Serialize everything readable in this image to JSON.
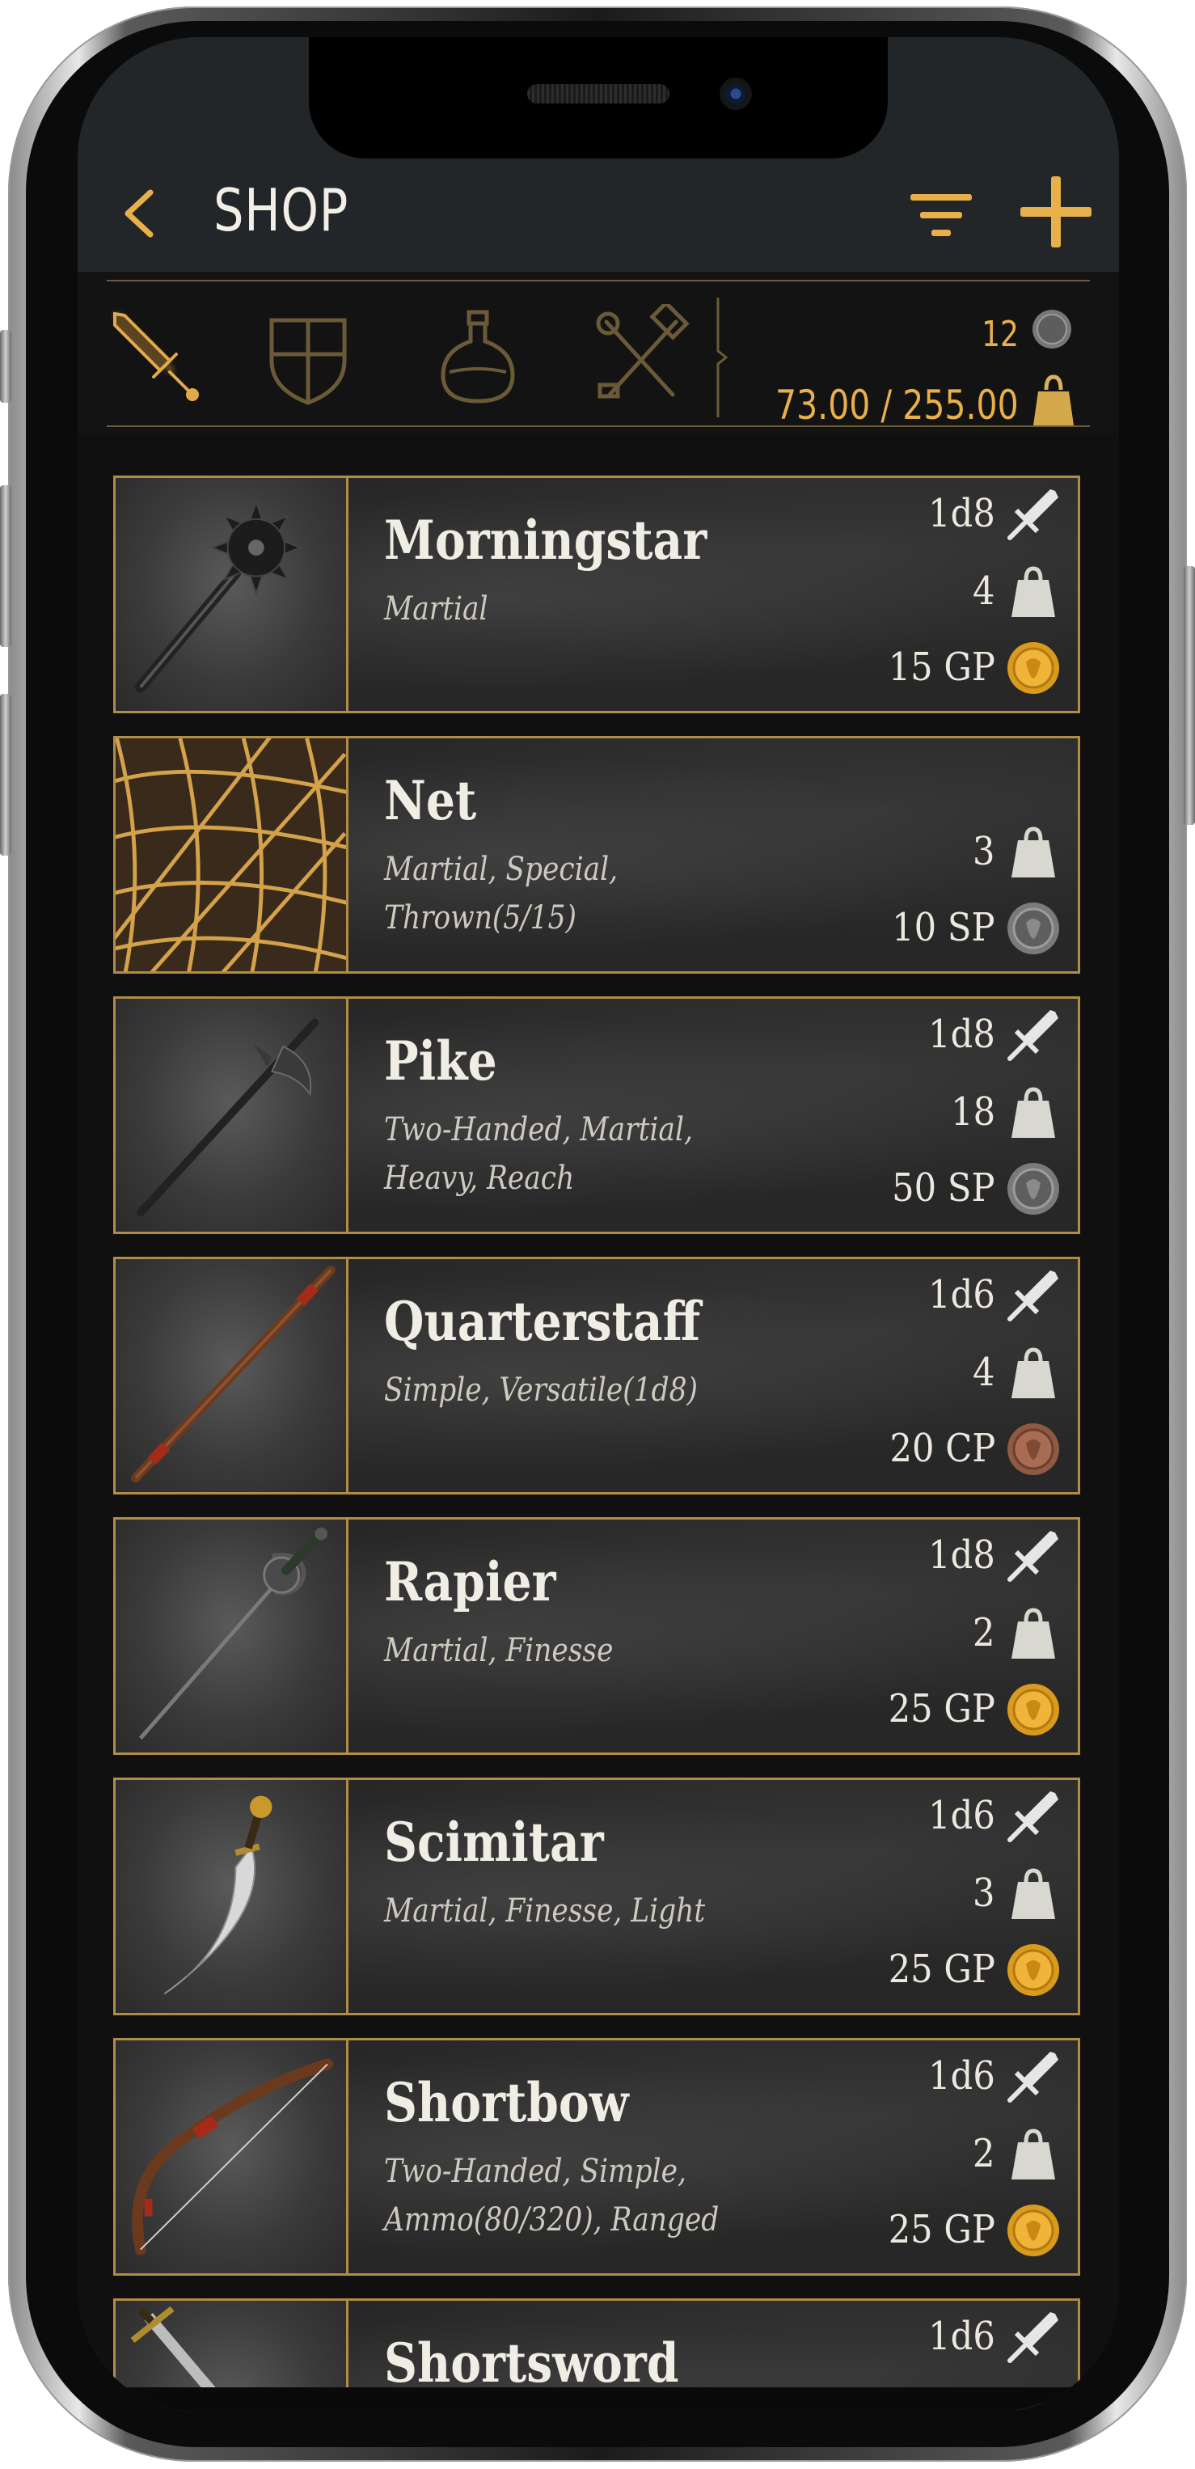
{
  "header": {
    "title": "SHOP"
  },
  "tabs": [
    {
      "name": "weapons",
      "icon": "sword-icon",
      "active": true
    },
    {
      "name": "armor",
      "icon": "shield-icon",
      "active": false
    },
    {
      "name": "potions",
      "icon": "potion-icon",
      "active": false
    },
    {
      "name": "tools",
      "icon": "tools-icon",
      "active": false
    }
  ],
  "wallet": {
    "coins": "12",
    "weight": "73.00 / 255.00"
  },
  "items": [
    {
      "name": "Morningstar",
      "props": "Martial",
      "damage": "1d8",
      "weight": "4",
      "cost": "15 GP",
      "currency": "gold"
    },
    {
      "name": "Net",
      "props": "Martial, Special, Thrown(5/15)",
      "damage": "",
      "weight": "3",
      "cost": "10 SP",
      "currency": "silver"
    },
    {
      "name": "Pike",
      "props": "Two-Handed, Martial, Heavy, Reach",
      "damage": "1d8",
      "weight": "18",
      "cost": "50 SP",
      "currency": "silver"
    },
    {
      "name": "Quarterstaff",
      "props": "Simple, Versatile(1d8)",
      "damage": "1d6",
      "weight": "4",
      "cost": "20 CP",
      "currency": "copper"
    },
    {
      "name": "Rapier",
      "props": "Martial, Finesse",
      "damage": "1d8",
      "weight": "2",
      "cost": "25 GP",
      "currency": "gold"
    },
    {
      "name": "Scimitar",
      "props": "Martial, Finesse, Light",
      "damage": "1d6",
      "weight": "3",
      "cost": "25 GP",
      "currency": "gold"
    },
    {
      "name": "Shortbow",
      "props": "Two-Handed, Simple, Ammo(80/320), Ranged",
      "damage": "1d6",
      "weight": "2",
      "cost": "25 GP",
      "currency": "gold"
    },
    {
      "name": "Shortsword",
      "props": "",
      "damage": "1d6",
      "weight": "",
      "cost": "",
      "currency": "gold"
    }
  ],
  "colors": {
    "accent": "#e8b04a",
    "border": "#b08c46",
    "gold": "#d99a1e",
    "silver": "#8a8a8a",
    "copper": "#a0644a"
  }
}
